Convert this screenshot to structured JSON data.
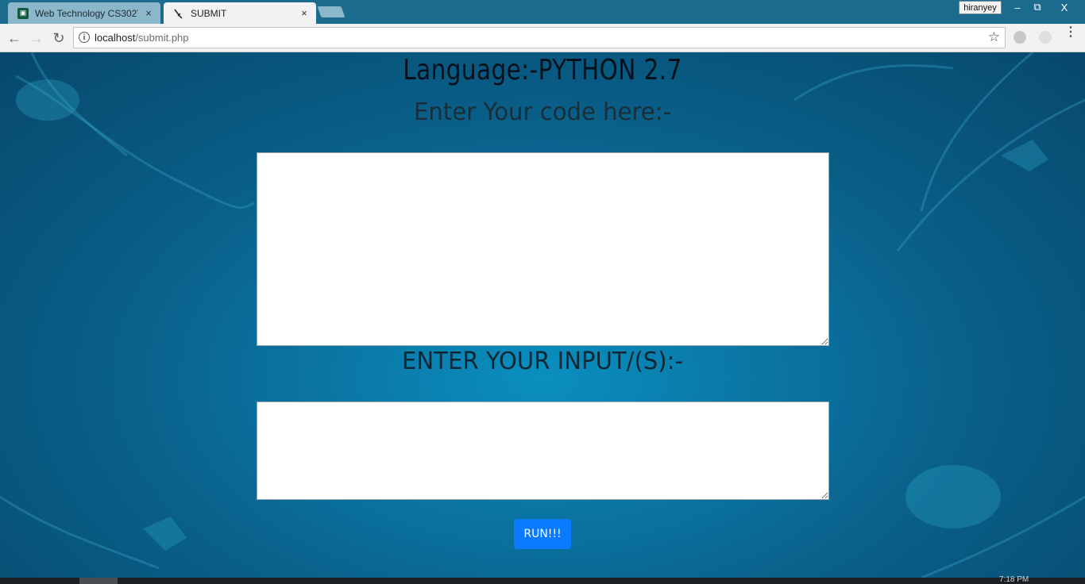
{
  "browser": {
    "tabs": [
      {
        "title": "Web Technology CS302T",
        "icon": "classroom-icon",
        "active": false
      },
      {
        "title": "SUBMIT",
        "icon": "code-favicon-icon",
        "active": true
      }
    ],
    "close_glyph": "×",
    "user_name": "hiranyey",
    "window_controls": {
      "minimize": "–",
      "restore": "⧉",
      "close": "X"
    },
    "address": {
      "host": "localhost",
      "path": "/submit.php"
    },
    "nav_icons": {
      "back": "←",
      "forward": "→",
      "reload": "↻",
      "star": "☆",
      "info": "i",
      "menu": "⋮"
    }
  },
  "page": {
    "language_heading": "Language:-PYTHON 2.7",
    "code_heading": "Enter Your code here:-",
    "input_heading": "ENTER YOUR INPUT/(S):-",
    "code_value": "",
    "input_value": "",
    "run_button": "RUN!!!"
  },
  "taskbar": {
    "clock": "7:18 PM"
  },
  "colors": {
    "page_bg": "#0a6f9c",
    "run_button": "#0a7bff",
    "titlebar": "#1b6b8f"
  }
}
